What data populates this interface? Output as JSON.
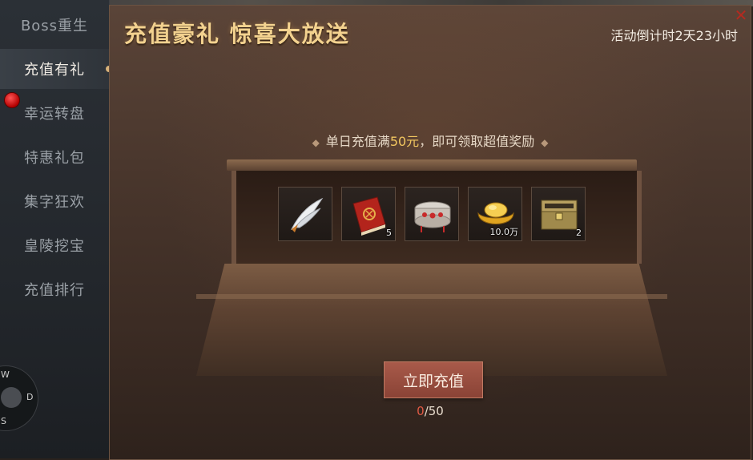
{
  "sidebar": {
    "items": [
      {
        "label": "Boss重生"
      },
      {
        "label": "充值有礼"
      },
      {
        "label": "幸运转盘"
      },
      {
        "label": "特惠礼包"
      },
      {
        "label": "集字狂欢"
      },
      {
        "label": "皇陵挖宝"
      },
      {
        "label": "充值排行"
      }
    ]
  },
  "compass": {
    "w": "W",
    "d": "D",
    "s": "S"
  },
  "panel": {
    "title": "充值豪礼 惊喜大放送",
    "countdown": "活动倒计时2天23小时",
    "close_icon": "close-icon",
    "hint_prefix": "单日充值满",
    "hint_amount": "50元",
    "hint_suffix": "，即可领取超值奖励"
  },
  "rewards": [
    {
      "icon": "white-feather-wing-icon",
      "count": ""
    },
    {
      "icon": "red-skill-book-icon",
      "count": "5"
    },
    {
      "icon": "jeweled-crown-icon",
      "count": ""
    },
    {
      "icon": "gold-ingot-icon",
      "count": "10.0万"
    },
    {
      "icon": "treasure-chest-icon",
      "count": "2"
    }
  ],
  "recharge": {
    "button_label": "立即充值",
    "current": "0",
    "target": "/50"
  },
  "colors": {
    "title": "#f3d28f",
    "highlight": "#f2c760",
    "button": "#a85a4a",
    "progress_current": "#e05a45"
  }
}
